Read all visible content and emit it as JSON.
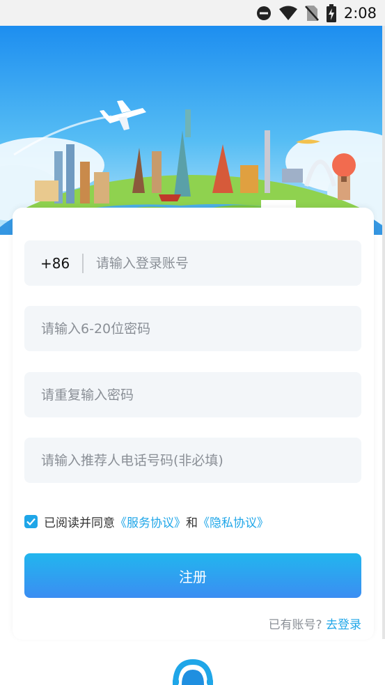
{
  "status_bar": {
    "time": "2:08"
  },
  "form": {
    "country_code": "+86",
    "account_placeholder": "请输入登录账号",
    "password_placeholder": "请输入6-20位密码",
    "repeat_password_placeholder": "请重复输入密码",
    "referrer_placeholder": "请输入推荐人电话号码(非必填)"
  },
  "agreement": {
    "checked": true,
    "prefix": "已阅读并同意",
    "service_link": "《服务协议》",
    "conjunction": "和",
    "privacy_link": "《隐私协议》"
  },
  "register_button": "注册",
  "login_prompt": {
    "question": "已有账号?",
    "link": "去登录"
  },
  "colors": {
    "accent": "#1fa6e8",
    "button_top": "#22b6ee",
    "button_bottom": "#3b8df2",
    "field_bg": "#f3f6f9",
    "placeholder": "#8a8f96"
  }
}
